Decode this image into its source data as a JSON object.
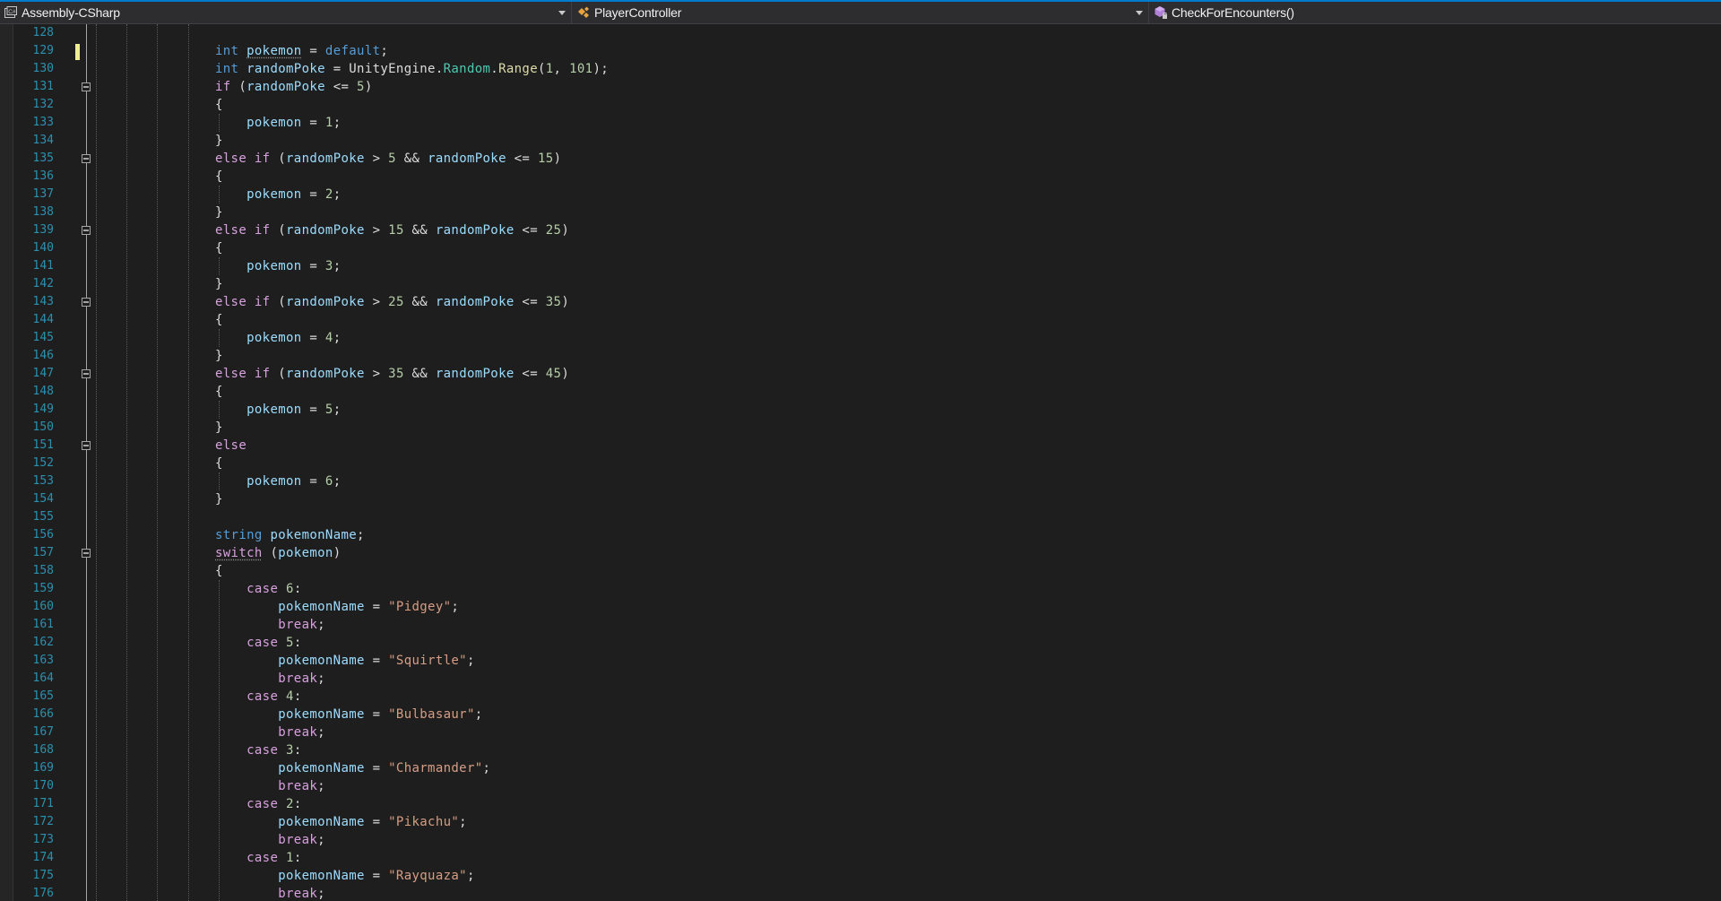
{
  "navbar": {
    "project": "Assembly-CSharp",
    "type": "PlayerController",
    "member": "CheckForEncounters()"
  },
  "icons": {
    "project": "csharp-project-icon",
    "type": "class-icon",
    "member": "method-icon",
    "caret": "chevron-down-icon"
  },
  "colors": {
    "line_number": "#2b91af",
    "keyword": "#569cd6",
    "control_keyword": "#d8a0df",
    "string": "#d69d85",
    "number": "#b5cea8",
    "type": "#4ec9b0",
    "variable": "#9cdcfe",
    "method": "#dcdcaa",
    "text": "#dcdcdc",
    "background": "#1e1e1e",
    "accent": "#007acc"
  },
  "editor": {
    "lines": [
      {
        "n": "128",
        "fold": false,
        "tokens": []
      },
      {
        "n": "129",
        "fold": false,
        "changed": true,
        "tokens": [
          [
            "kw",
            "int"
          ],
          [
            "t",
            " "
          ],
          [
            "var squig",
            "pokemon"
          ],
          [
            "t",
            " = "
          ],
          [
            "kw",
            "default"
          ],
          [
            "t",
            ";"
          ]
        ]
      },
      {
        "n": "130",
        "fold": false,
        "tokens": [
          [
            "kw",
            "int"
          ],
          [
            "t",
            " "
          ],
          [
            "var",
            "randomPoke"
          ],
          [
            "t",
            " = UnityEngine."
          ],
          [
            "typ",
            "Random"
          ],
          [
            "t",
            "."
          ],
          [
            "fn",
            "Range"
          ],
          [
            "t",
            "("
          ],
          [
            "num",
            "1"
          ],
          [
            "t",
            ", "
          ],
          [
            "num",
            "101"
          ],
          [
            "t",
            ");"
          ]
        ]
      },
      {
        "n": "131",
        "fold": true,
        "tokens": [
          [
            "ctl",
            "if"
          ],
          [
            "t",
            " ("
          ],
          [
            "var",
            "randomPoke"
          ],
          [
            "t",
            " <= "
          ],
          [
            "num",
            "5"
          ],
          [
            "t",
            ")"
          ]
        ]
      },
      {
        "n": "132",
        "fold": false,
        "tokens": [
          [
            "t",
            "{"
          ]
        ]
      },
      {
        "n": "133",
        "fold": false,
        "tokens": [
          [
            "t",
            "    "
          ],
          [
            "var",
            "pokemon"
          ],
          [
            "t",
            " = "
          ],
          [
            "num",
            "1"
          ],
          [
            "t",
            ";"
          ]
        ]
      },
      {
        "n": "134",
        "fold": false,
        "tokens": [
          [
            "t",
            "}"
          ]
        ]
      },
      {
        "n": "135",
        "fold": true,
        "tokens": [
          [
            "ctl",
            "else"
          ],
          [
            "t",
            " "
          ],
          [
            "ctl",
            "if"
          ],
          [
            "t",
            " ("
          ],
          [
            "var",
            "randomPoke"
          ],
          [
            "t",
            " > "
          ],
          [
            "num",
            "5"
          ],
          [
            "t",
            " && "
          ],
          [
            "var",
            "randomPoke"
          ],
          [
            "t",
            " <= "
          ],
          [
            "num",
            "15"
          ],
          [
            "t",
            ")"
          ]
        ]
      },
      {
        "n": "136",
        "fold": false,
        "tokens": [
          [
            "t",
            "{"
          ]
        ]
      },
      {
        "n": "137",
        "fold": false,
        "tokens": [
          [
            "t",
            "    "
          ],
          [
            "var",
            "pokemon"
          ],
          [
            "t",
            " = "
          ],
          [
            "num",
            "2"
          ],
          [
            "t",
            ";"
          ]
        ]
      },
      {
        "n": "138",
        "fold": false,
        "tokens": [
          [
            "t",
            "}"
          ]
        ]
      },
      {
        "n": "139",
        "fold": true,
        "tokens": [
          [
            "ctl",
            "else"
          ],
          [
            "t",
            " "
          ],
          [
            "ctl",
            "if"
          ],
          [
            "t",
            " ("
          ],
          [
            "var",
            "randomPoke"
          ],
          [
            "t",
            " > "
          ],
          [
            "num",
            "15"
          ],
          [
            "t",
            " && "
          ],
          [
            "var",
            "randomPoke"
          ],
          [
            "t",
            " <= "
          ],
          [
            "num",
            "25"
          ],
          [
            "t",
            ")"
          ]
        ]
      },
      {
        "n": "140",
        "fold": false,
        "tokens": [
          [
            "t",
            "{"
          ]
        ]
      },
      {
        "n": "141",
        "fold": false,
        "tokens": [
          [
            "t",
            "    "
          ],
          [
            "var",
            "pokemon"
          ],
          [
            "t",
            " = "
          ],
          [
            "num",
            "3"
          ],
          [
            "t",
            ";"
          ]
        ]
      },
      {
        "n": "142",
        "fold": false,
        "tokens": [
          [
            "t",
            "}"
          ]
        ]
      },
      {
        "n": "143",
        "fold": true,
        "tokens": [
          [
            "ctl",
            "else"
          ],
          [
            "t",
            " "
          ],
          [
            "ctl",
            "if"
          ],
          [
            "t",
            " ("
          ],
          [
            "var",
            "randomPoke"
          ],
          [
            "t",
            " > "
          ],
          [
            "num",
            "25"
          ],
          [
            "t",
            " && "
          ],
          [
            "var",
            "randomPoke"
          ],
          [
            "t",
            " <= "
          ],
          [
            "num",
            "35"
          ],
          [
            "t",
            ")"
          ]
        ]
      },
      {
        "n": "144",
        "fold": false,
        "tokens": [
          [
            "t",
            "{"
          ]
        ]
      },
      {
        "n": "145",
        "fold": false,
        "tokens": [
          [
            "t",
            "    "
          ],
          [
            "var",
            "pokemon"
          ],
          [
            "t",
            " = "
          ],
          [
            "num",
            "4"
          ],
          [
            "t",
            ";"
          ]
        ]
      },
      {
        "n": "146",
        "fold": false,
        "tokens": [
          [
            "t",
            "}"
          ]
        ]
      },
      {
        "n": "147",
        "fold": true,
        "tokens": [
          [
            "ctl",
            "else"
          ],
          [
            "t",
            " "
          ],
          [
            "ctl",
            "if"
          ],
          [
            "t",
            " ("
          ],
          [
            "var",
            "randomPoke"
          ],
          [
            "t",
            " > "
          ],
          [
            "num",
            "35"
          ],
          [
            "t",
            " && "
          ],
          [
            "var",
            "randomPoke"
          ],
          [
            "t",
            " <= "
          ],
          [
            "num",
            "45"
          ],
          [
            "t",
            ")"
          ]
        ]
      },
      {
        "n": "148",
        "fold": false,
        "tokens": [
          [
            "t",
            "{"
          ]
        ]
      },
      {
        "n": "149",
        "fold": false,
        "tokens": [
          [
            "t",
            "    "
          ],
          [
            "var",
            "pokemon"
          ],
          [
            "t",
            " = "
          ],
          [
            "num",
            "5"
          ],
          [
            "t",
            ";"
          ]
        ]
      },
      {
        "n": "150",
        "fold": false,
        "tokens": [
          [
            "t",
            "}"
          ]
        ]
      },
      {
        "n": "151",
        "fold": true,
        "tokens": [
          [
            "ctl",
            "else"
          ]
        ]
      },
      {
        "n": "152",
        "fold": false,
        "tokens": [
          [
            "t",
            "{"
          ]
        ]
      },
      {
        "n": "153",
        "fold": false,
        "tokens": [
          [
            "t",
            "    "
          ],
          [
            "var",
            "pokemon"
          ],
          [
            "t",
            " = "
          ],
          [
            "num",
            "6"
          ],
          [
            "t",
            ";"
          ]
        ]
      },
      {
        "n": "154",
        "fold": false,
        "tokens": [
          [
            "t",
            "}"
          ]
        ]
      },
      {
        "n": "155",
        "fold": false,
        "tokens": []
      },
      {
        "n": "156",
        "fold": false,
        "tokens": [
          [
            "kw",
            "string"
          ],
          [
            "t",
            " "
          ],
          [
            "var",
            "pokemonName"
          ],
          [
            "t",
            ";"
          ]
        ]
      },
      {
        "n": "157",
        "fold": true,
        "tokens": [
          [
            "ctl squig",
            "switch"
          ],
          [
            "t",
            " ("
          ],
          [
            "var",
            "pokemon"
          ],
          [
            "t",
            ")"
          ]
        ]
      },
      {
        "n": "158",
        "fold": false,
        "tokens": [
          [
            "t",
            "{"
          ]
        ]
      },
      {
        "n": "159",
        "fold": false,
        "tokens": [
          [
            "t",
            "    "
          ],
          [
            "ctl",
            "case"
          ],
          [
            "t",
            " "
          ],
          [
            "num",
            "6"
          ],
          [
            "t",
            ":"
          ]
        ]
      },
      {
        "n": "160",
        "fold": false,
        "tokens": [
          [
            "t",
            "        "
          ],
          [
            "var",
            "pokemonName"
          ],
          [
            "t",
            " = "
          ],
          [
            "str",
            "\"Pidgey\""
          ],
          [
            "t",
            ";"
          ]
        ]
      },
      {
        "n": "161",
        "fold": false,
        "tokens": [
          [
            "t",
            "        "
          ],
          [
            "ctl",
            "break"
          ],
          [
            "t",
            ";"
          ]
        ]
      },
      {
        "n": "162",
        "fold": false,
        "tokens": [
          [
            "t",
            "    "
          ],
          [
            "ctl",
            "case"
          ],
          [
            "t",
            " "
          ],
          [
            "num",
            "5"
          ],
          [
            "t",
            ":"
          ]
        ]
      },
      {
        "n": "163",
        "fold": false,
        "tokens": [
          [
            "t",
            "        "
          ],
          [
            "var",
            "pokemonName"
          ],
          [
            "t",
            " = "
          ],
          [
            "str",
            "\"Squirtle\""
          ],
          [
            "t",
            ";"
          ]
        ]
      },
      {
        "n": "164",
        "fold": false,
        "tokens": [
          [
            "t",
            "        "
          ],
          [
            "ctl",
            "break"
          ],
          [
            "t",
            ";"
          ]
        ]
      },
      {
        "n": "165",
        "fold": false,
        "tokens": [
          [
            "t",
            "    "
          ],
          [
            "ctl",
            "case"
          ],
          [
            "t",
            " "
          ],
          [
            "num",
            "4"
          ],
          [
            "t",
            ":"
          ]
        ]
      },
      {
        "n": "166",
        "fold": false,
        "tokens": [
          [
            "t",
            "        "
          ],
          [
            "var",
            "pokemonName"
          ],
          [
            "t",
            " = "
          ],
          [
            "str",
            "\"Bulbasaur\""
          ],
          [
            "t",
            ";"
          ]
        ]
      },
      {
        "n": "167",
        "fold": false,
        "tokens": [
          [
            "t",
            "        "
          ],
          [
            "ctl",
            "break"
          ],
          [
            "t",
            ";"
          ]
        ]
      },
      {
        "n": "168",
        "fold": false,
        "tokens": [
          [
            "t",
            "    "
          ],
          [
            "ctl",
            "case"
          ],
          [
            "t",
            " "
          ],
          [
            "num",
            "3"
          ],
          [
            "t",
            ":"
          ]
        ]
      },
      {
        "n": "169",
        "fold": false,
        "tokens": [
          [
            "t",
            "        "
          ],
          [
            "var",
            "pokemonName"
          ],
          [
            "t",
            " = "
          ],
          [
            "str",
            "\"Charmander\""
          ],
          [
            "t",
            ";"
          ]
        ]
      },
      {
        "n": "170",
        "fold": false,
        "tokens": [
          [
            "t",
            "        "
          ],
          [
            "ctl",
            "break"
          ],
          [
            "t",
            ";"
          ]
        ]
      },
      {
        "n": "171",
        "fold": false,
        "tokens": [
          [
            "t",
            "    "
          ],
          [
            "ctl",
            "case"
          ],
          [
            "t",
            " "
          ],
          [
            "num",
            "2"
          ],
          [
            "t",
            ":"
          ]
        ]
      },
      {
        "n": "172",
        "fold": false,
        "tokens": [
          [
            "t",
            "        "
          ],
          [
            "var",
            "pokemonName"
          ],
          [
            "t",
            " = "
          ],
          [
            "str",
            "\"Pikachu\""
          ],
          [
            "t",
            ";"
          ]
        ]
      },
      {
        "n": "173",
        "fold": false,
        "tokens": [
          [
            "t",
            "        "
          ],
          [
            "ctl",
            "break"
          ],
          [
            "t",
            ";"
          ]
        ]
      },
      {
        "n": "174",
        "fold": false,
        "tokens": [
          [
            "t",
            "    "
          ],
          [
            "ctl",
            "case"
          ],
          [
            "t",
            " "
          ],
          [
            "num",
            "1"
          ],
          [
            "t",
            ":"
          ]
        ]
      },
      {
        "n": "175",
        "fold": false,
        "tokens": [
          [
            "t",
            "        "
          ],
          [
            "var",
            "pokemonName"
          ],
          [
            "t",
            " = "
          ],
          [
            "str",
            "\"Rayquaza\""
          ],
          [
            "t",
            ";"
          ]
        ]
      },
      {
        "n": "176",
        "fold": false,
        "tokens": [
          [
            "t",
            "        "
          ],
          [
            "ctl",
            "break"
          ],
          [
            "t",
            ";"
          ]
        ]
      }
    ]
  }
}
